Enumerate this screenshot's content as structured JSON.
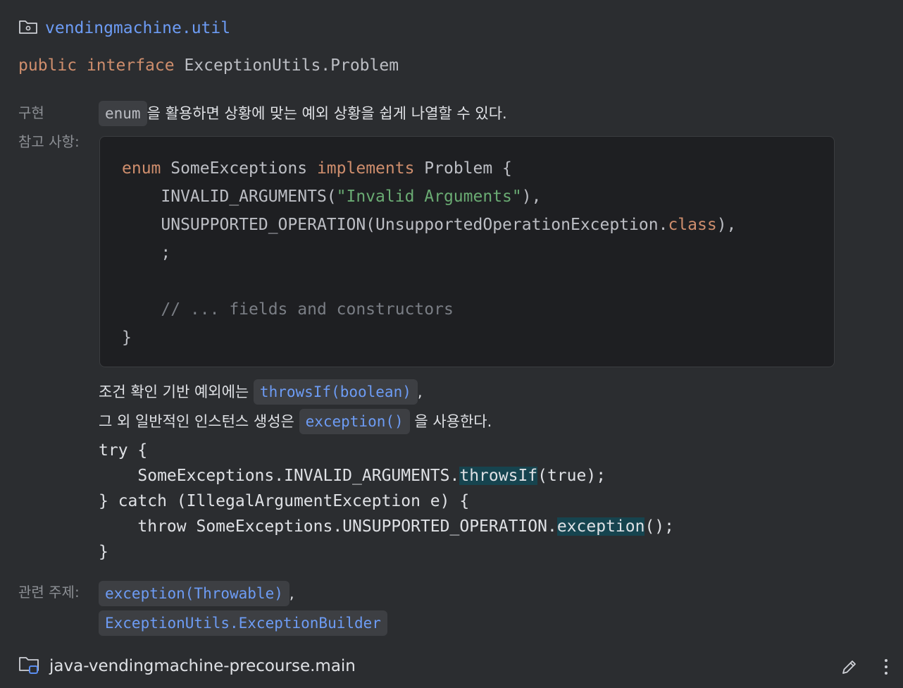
{
  "package": {
    "name": "vendingmachine.util",
    "icon": "folder-package-icon"
  },
  "signature": {
    "kw1": "public",
    "kw2": "interface",
    "name": "ExceptionUtils.Problem"
  },
  "impl_note": {
    "label_line1": "구현",
    "label_line2": "참고 사항:",
    "chip": "enum",
    "text": "을 활용하면 상황에 맞는 예외 상황을 쉽게 나열할 수 있다."
  },
  "code_block": {
    "l1": {
      "kw": "enum",
      "name": " SomeExceptions ",
      "kw2": "implements",
      "rest": " Problem {"
    },
    "l2": {
      "pre": "    INVALID_ARGUMENTS(",
      "str": "\"Invalid Arguments\"",
      "post": "),"
    },
    "l3": {
      "pre": "    UNSUPPORTED_OPERATION(UnsupportedOperationException.",
      "kw": "class",
      "post": "),"
    },
    "l4": "    ;",
    "l5": "    // ... fields and constructors",
    "l6": "}"
  },
  "usage": {
    "line1_text": "조건 확인 기반 예외에는",
    "line1_chip": "throwsIf(boolean)",
    "line1_post": ",",
    "line2_text": "그 외 일반적인 인스턴스 생성은",
    "line2_chip": "exception()",
    "line2_post": "을 사용한다."
  },
  "code_example": {
    "l1": "try {",
    "l2": {
      "pre": "    SomeExceptions.INVALID_ARGUMENTS.",
      "hl": "throwsIf",
      "post": "(true);"
    },
    "l3": "} catch (IllegalArgumentException e) {",
    "l4": {
      "pre": "    throw SomeExceptions.UNSUPPORTED_OPERATION.",
      "hl": "exception",
      "post": "();"
    },
    "l5": "}"
  },
  "related": {
    "label": "관련 주제:",
    "link1": "exception(Throwable)",
    "sep": ",",
    "link2": "ExceptionUtils.ExceptionBuilder"
  },
  "footer": {
    "module": "java-vendingmachine-precourse.main",
    "icons": [
      "module-folder-icon",
      "edit-pencil-icon",
      "more-vertical-icon"
    ]
  },
  "colors": {
    "background": "#2b2d30",
    "link": "#6d9cf5",
    "keyword": "#cf8e6d",
    "string": "#6aab73",
    "comment": "#7a7e85",
    "highlight": "#16444f"
  }
}
